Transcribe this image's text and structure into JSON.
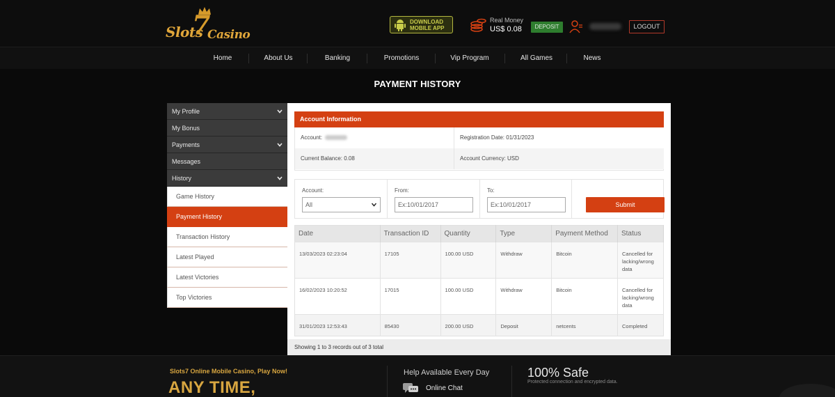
{
  "header": {
    "logo": {
      "text_a": "Slots",
      "seven": "7",
      "text_b": "Casino"
    },
    "download_app": {
      "line1": "DOWNLOAD",
      "line2": "MOBILE APP"
    },
    "real_money_label": "Real Money",
    "real_money_value": "US$ 0.08",
    "deposit_label": "DEPOSIT",
    "logout_label": "LOGOUT",
    "accent_color": "#d44012"
  },
  "nav": {
    "items": [
      {
        "label": "Home"
      },
      {
        "label": "About Us"
      },
      {
        "label": "Banking"
      },
      {
        "label": "Promotions"
      },
      {
        "label": "Vip Program"
      },
      {
        "label": "All Games"
      },
      {
        "label": "News"
      }
    ]
  },
  "page_title": "PAYMENT HISTORY",
  "sidebar": {
    "sections": [
      {
        "label": "My Profile",
        "expandable": true
      },
      {
        "label": "My Bonus",
        "expandable": false
      },
      {
        "label": "Payments",
        "expandable": true
      },
      {
        "label": "Messages",
        "expandable": false
      },
      {
        "label": "History",
        "expandable": true
      }
    ],
    "history_items": [
      {
        "label": "Game History"
      },
      {
        "label": "Payment History",
        "active": true
      },
      {
        "label": "Transaction History"
      },
      {
        "label": "Latest Played"
      },
      {
        "label": "Latest Victories"
      },
      {
        "label": "Top Victories"
      }
    ]
  },
  "account": {
    "heading": "Account Information",
    "account_label": "Account:",
    "registration_date": "Registration Date: 01/31/2023",
    "current_balance": "Current Balance: 0.08",
    "account_currency": "Account Currency: USD"
  },
  "filter": {
    "account_label": "Account:",
    "account_value": "All",
    "from_label": "From:",
    "from_placeholder": "Ex:10/01/2017",
    "to_label": "To:",
    "to_placeholder": "Ex:10/01/2017",
    "submit_label": "Submit"
  },
  "table": {
    "columns": [
      "Date",
      "Transaction ID",
      "Quantity",
      "Type",
      "Payment Method",
      "Status"
    ],
    "rows": [
      {
        "date": "13/03/2023 02:23:04",
        "id": "17105",
        "quantity": "100.00 USD",
        "type": "Withdraw",
        "method": "Bitcoin",
        "status": "Cancelled for lacking/wrong data"
      },
      {
        "date": "16/02/2023 10:20:52",
        "id": "17015",
        "quantity": "100.00 USD",
        "type": "Withdraw",
        "method": "Bitcoin",
        "status": "Cancelled for lacking/wrong data"
      },
      {
        "date": "31/01/2023 12:53:43",
        "id": "85430",
        "quantity": "200.00 USD",
        "type": "Deposit",
        "method": "netcents",
        "status": "Completed"
      }
    ],
    "footer": "Showing 1 to 3 records out of 3 total"
  },
  "bottom": {
    "promo_small": "Slots7 Online Mobile Casino, Play Now!",
    "promo_big": "ANY TIME,",
    "help_title": "Help Available Every Day",
    "chat_label": "Online Chat",
    "safe_title": "100% Safe",
    "safe_sub": "Protected connection and encrypted data."
  }
}
